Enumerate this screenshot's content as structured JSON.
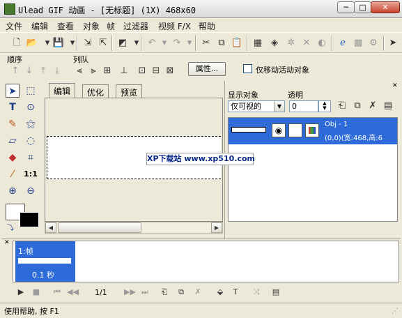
{
  "window": {
    "title": "Ulead GIF 动画 - [无标题] (1X) 468x60",
    "minimize": "─",
    "maximize": "□",
    "close": "✕"
  },
  "menu": [
    "文件",
    "编辑",
    "查看",
    "对象",
    "帧",
    "过滤器",
    "视频 F/X",
    "帮助"
  ],
  "toolbar_icons": [
    "new-file-icon",
    "open-folder-icon",
    "save-icon",
    "import-icon",
    "export-icon",
    "color-palette-icon",
    "undo-icon",
    "redo-icon",
    "cut-icon",
    "copy-icon",
    "paste-icon",
    "frame-properties-icon",
    "optimize-icon",
    "filter-icon",
    "transform-icon",
    "effect-icon",
    "browser-preview-icon",
    "disabled-tool-icon",
    "settings-icon",
    "help-cursor-icon"
  ],
  "order_section": {
    "order_label": "顺序",
    "queue_label": "列队",
    "properties_button": "属性...",
    "move_active_only_label": "仅移动活动对象",
    "move_active_only_checked": false
  },
  "editor_tabs": [
    "编辑",
    "优化",
    "预览"
  ],
  "active_tab": "编辑",
  "object_panel": {
    "display_label": "显示对象",
    "transparent_label": "透明",
    "display_value": "仅可视的",
    "transparent_value": "0",
    "object": {
      "name": "Obj - 1",
      "info": "(0,0)(宽:468,高:6"
    }
  },
  "frame_panel": {
    "frame_label": "1:帧",
    "frame_delay": "0.1 秒",
    "frame_counter": "1/1"
  },
  "watermark": "XP下载站 www.xp510.com",
  "status": "使用帮助, 按 F1",
  "colors": {
    "selection": "#2e6bd8",
    "chrome": "#ECE9D8",
    "foreground_swatch": "#FFFFFF",
    "background_swatch": "#000000"
  }
}
